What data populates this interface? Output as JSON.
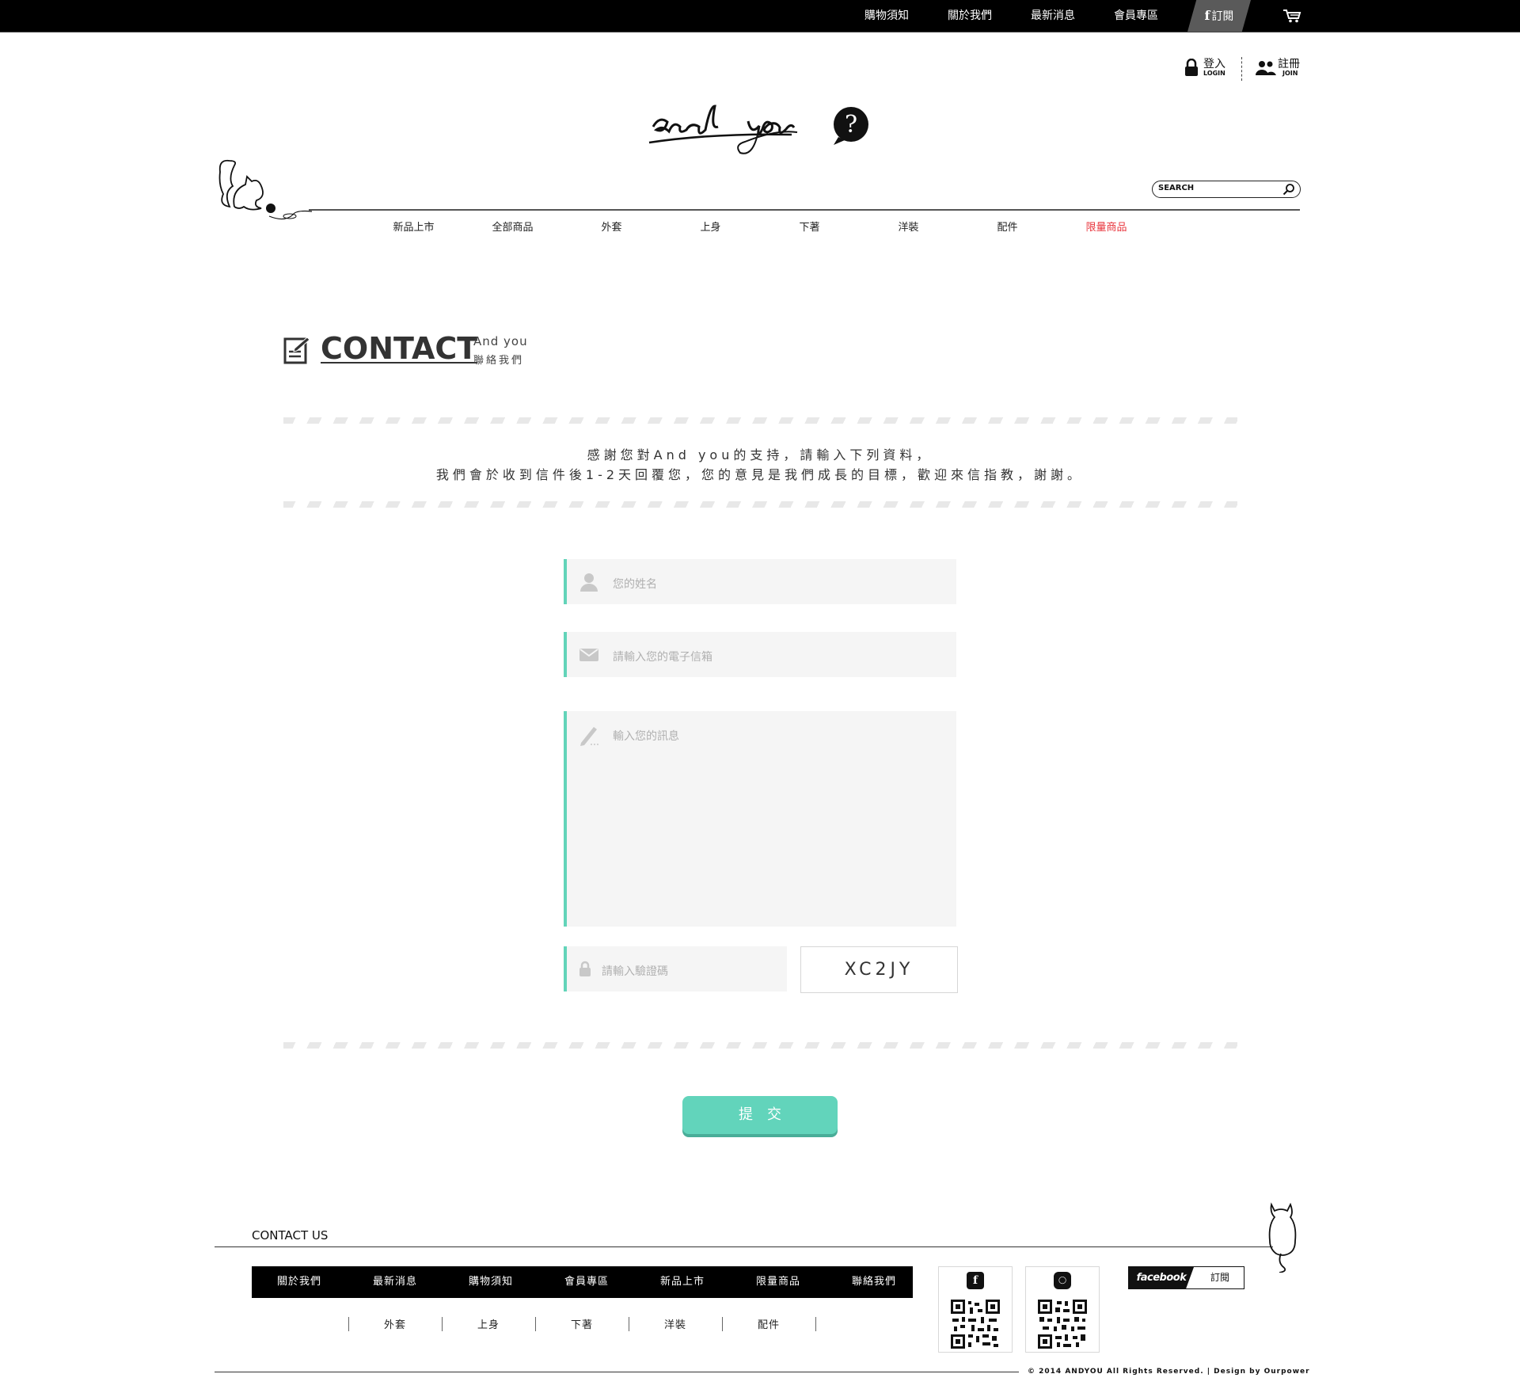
{
  "topbar": {
    "links": [
      "購物須知",
      "關於我們",
      "最新消息",
      "會員專區"
    ],
    "fb_subscribe": "訂閱",
    "fb_letter": "f"
  },
  "account": {
    "login": {
      "cn": "登入",
      "en": "LOGIN"
    },
    "join": {
      "cn": "註冊",
      "en": "JOIN"
    }
  },
  "search": {
    "label": "SEARCH"
  },
  "nav": {
    "items": [
      "新品上市",
      "全部商品",
      "外套",
      "上身",
      "下著",
      "洋裝",
      "配件",
      "限量商品"
    ],
    "highlight_color": "#e8343c"
  },
  "heading": {
    "title": "CONTACT",
    "sub_en": "And you",
    "sub_cn": "聯絡我們"
  },
  "intro": {
    "line1": "感謝您對And you的支持，請輸入下列資料，",
    "line2": "我們會於收到信件後1-2天回覆您，您的意見是我們成長的目標，歡迎來信指教，謝謝。"
  },
  "form": {
    "name_placeholder": "您的姓名",
    "email_placeholder": "請輸入您的電子信箱",
    "message_placeholder": "輸入您的訊息",
    "captcha_placeholder": "請輸入驗證碼",
    "captcha_code": "XC2JY",
    "submit_label": "提交",
    "accent_color": "#62d4b9"
  },
  "footer": {
    "title": "CONTACT US",
    "nav": [
      "關於我們",
      "最新消息",
      "購物須知",
      "會員專區",
      "新品上市",
      "限量商品",
      "聯絡我們"
    ],
    "subnav": [
      "外套",
      "上身",
      "下著",
      "洋裝",
      "配件"
    ],
    "fb_label": "facebook",
    "fb_subscribe": "訂閱",
    "copyright": "© 2014 ANDYOU All Rights Reserved. | Design by Ourpower"
  }
}
